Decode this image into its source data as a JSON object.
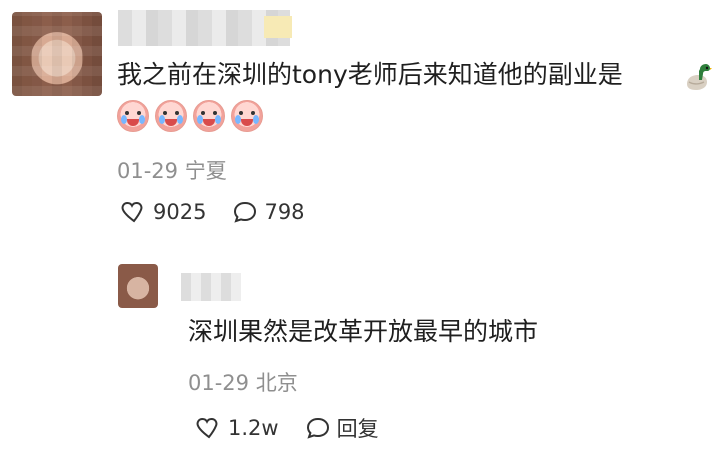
{
  "comment": {
    "text": "我之前在深圳的tony老师后来知道他的副业是",
    "meta": {
      "date": "01-29",
      "location": "宁夏"
    },
    "stats": {
      "likes": "9025",
      "replies": "798"
    }
  },
  "reply": {
    "text": "深圳果然是改革开放最早的城市",
    "meta": {
      "date": "01-29",
      "location": "北京"
    },
    "stats": {
      "likes": "1.2w",
      "reply_label": "回复"
    }
  },
  "icons": {
    "like": "heart-outline-icon",
    "comment": "speech-bubble-outline-icon",
    "emoji_duck": "duck-emoji-icon",
    "emoji_crying": "crying-face-emoji-icon"
  }
}
